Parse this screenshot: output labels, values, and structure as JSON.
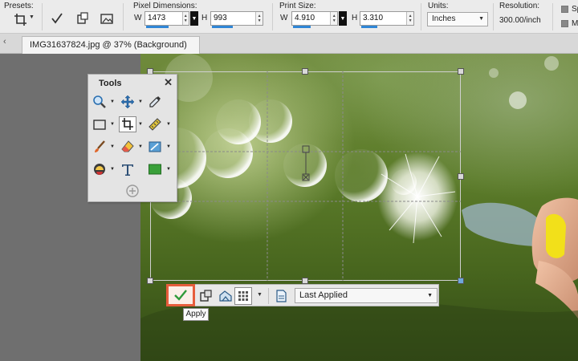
{
  "toolbar": {
    "presets_label": "Presets:",
    "pixel_dimensions_label": "Pixel Dimensions:",
    "width_prefix": "W",
    "width_value": "1473",
    "height_prefix": "H",
    "height_value": "993",
    "print_size_label": "Print Size:",
    "print_width_prefix": "W",
    "print_width_value": "4.910",
    "print_height_prefix": "H",
    "print_height_value": "3.310",
    "units_label": "Units:",
    "units_value": "Inches",
    "resolution_label": "Resolution:",
    "resolution_value": "300.00/inch",
    "option_1_label": "Sp",
    "option_2_label": "M"
  },
  "tab": {
    "title": "IMG31637824.jpg @  37% (Background)"
  },
  "tools_palette": {
    "title": "Tools",
    "close_glyph": "✕"
  },
  "crop_toolbar": {
    "tooltip": "Apply",
    "preset_value": "Last Applied"
  },
  "colors": {
    "accent_blue": "#2f86d6",
    "apply_highlight": "#e65d3c",
    "apply_check": "#2f9a3a",
    "fill_color_swatch": "#3aa03a"
  }
}
